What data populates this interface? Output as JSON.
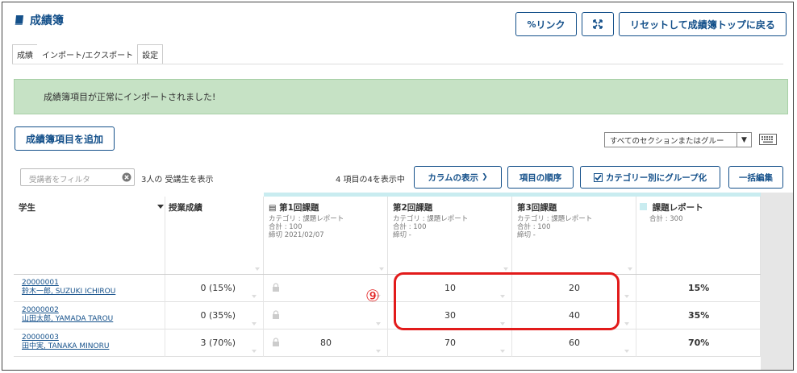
{
  "header": {
    "title": "成績簿",
    "link_label": "リンク",
    "reset_label": "リセットして成績簿トップに戻る"
  },
  "tabs": [
    {
      "label": "成績"
    },
    {
      "label": "インポート/エクスポート"
    },
    {
      "label": "設定"
    }
  ],
  "alert": {
    "message": "成績簿項目が正常にインポートされました!"
  },
  "toolbar": {
    "add_item_label": "成績簿項目を追加",
    "section_select_value": "すべてのセクションまたはグルー"
  },
  "filter": {
    "placeholder": "受講者をフィルタ",
    "student_count": "3人の 受講生を表示",
    "item_count": "4 項目の4を表示中",
    "columns_label": "カラムの表示",
    "order_label": "項目の順序",
    "group_label": "カテゴリー別にグループ化",
    "bulk_edit_label": "一括編集"
  },
  "columns": {
    "student": {
      "name": "学生"
    },
    "course_grade": {
      "name": "授業成績"
    },
    "a1": {
      "name": "第1回課題",
      "category": "カテゴリ : 課題レポート",
      "total": "合計 : 100",
      "due": "締切 2021/02/07"
    },
    "a2": {
      "name": "第2回課題",
      "category": "カテゴリ : 課題レポート",
      "total": "合計 : 100",
      "due": "締切 -"
    },
    "a3": {
      "name": "第3回課題",
      "category": "カテゴリ : 課題レポート",
      "total": "合計 : 100",
      "due": "締切 -"
    },
    "report": {
      "name": "課題レポート",
      "total": "合計 : 300"
    }
  },
  "rows": [
    {
      "id": "20000001",
      "name": "鈴木一郎, SUZUKI ICHIROU",
      "course_grade": "0 (15%)",
      "a1": "",
      "a2": "10",
      "a3": "20",
      "report": "15%"
    },
    {
      "id": "20000002",
      "name": "山田太郎, YAMADA TAROU",
      "course_grade": "0 (35%)",
      "a1": "",
      "a2": "30",
      "a3": "40",
      "report": "35%"
    },
    {
      "id": "20000003",
      "name": "田中実, TANAKA MINORU",
      "course_grade": "3 (70%)",
      "a1": "80",
      "a2": "70",
      "a3": "60",
      "report": "70%"
    }
  ],
  "annotation": {
    "marker": "⑨",
    "color": "#e21b1b"
  },
  "colors": {
    "accent": "#14508a",
    "success_bg": "#c6e2c5"
  }
}
